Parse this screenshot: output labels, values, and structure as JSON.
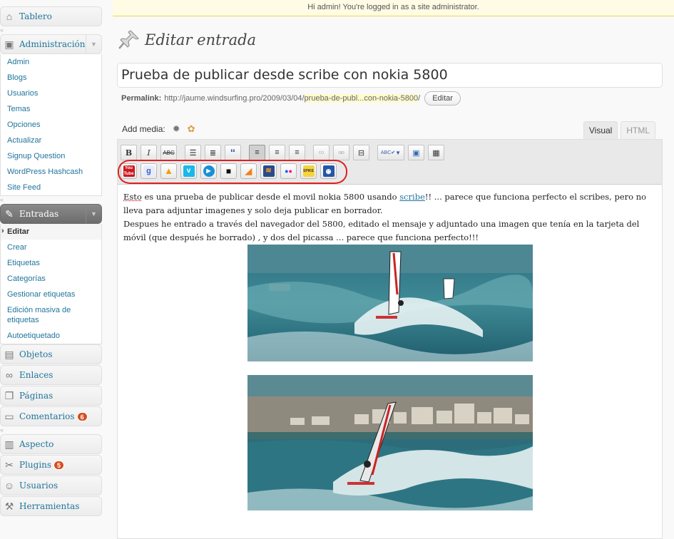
{
  "topbar": {
    "message": "Hi admin! You're logged in as a site administrator."
  },
  "sidebar": {
    "dashboard": "Tablero",
    "admin_section": {
      "label": "Administración",
      "items": [
        "Admin",
        "Blogs",
        "Usuarios",
        "Temas",
        "Opciones",
        "Actualizar",
        "Signup Question",
        "WordPress Hashcash",
        "Site Feed"
      ]
    },
    "posts_section": {
      "label": "Entradas",
      "items": [
        "Editar",
        "Crear",
        "Etiquetas",
        "Categorías",
        "Gestionar etiquetas",
        "Edición masiva de etiquetas",
        "Autoetiquetado"
      ]
    },
    "menu": {
      "media": "Objetos",
      "links": "Enlaces",
      "pages": "Páginas",
      "comments": "Comentarios",
      "comments_count": "6",
      "appearance": "Aspecto",
      "plugins": "Plugins",
      "plugins_count": "5",
      "users": "Usuarios",
      "tools": "Herramientas"
    }
  },
  "page": {
    "heading": "Editar entrada"
  },
  "post": {
    "title": "Prueba de publicar desde scribe con nokia 5800",
    "permalink_label": "Permalink:",
    "permalink_base": "http://jaume.windsurfing.pro/2009/03/04/",
    "permalink_slug": "prueba-de-publ...con-nokia-5800",
    "permalink_end": "/",
    "edit_button": "Editar"
  },
  "media": {
    "label": "Add media:"
  },
  "editor_tabs": {
    "visual": "Visual",
    "html": "HTML"
  },
  "toolbar": {
    "bold": "B",
    "italic": "I",
    "strike": "ABC",
    "spell": "ABC"
  },
  "media_buttons": [
    {
      "name": "youtube",
      "label": "You Tube",
      "color": "#cc181e"
    },
    {
      "name": "google-video",
      "label": "g",
      "color": "#3a5fcd"
    },
    {
      "name": "metacafe",
      "label": "▲",
      "color": "#f0a000"
    },
    {
      "name": "vimeo",
      "label": "v",
      "color": "#1ab7ea"
    },
    {
      "name": "dailymotion",
      "label": "▶",
      "color": "#1a8fd6"
    },
    {
      "name": "video-camera",
      "label": "●",
      "color": "#111111"
    },
    {
      "name": "myspace",
      "label": "◢",
      "color": "#f08020"
    },
    {
      "name": "revver",
      "label": "≋",
      "color": "#2b4a8b"
    },
    {
      "name": "flickr",
      "label": "●●",
      "color": "#ffffff"
    },
    {
      "name": "spike",
      "label": "SPIKE",
      "color": "#f6d43b"
    },
    {
      "name": "bliptv",
      "label": "●",
      "color": "#2456a6"
    }
  ],
  "content": {
    "p1_a": "Esto",
    "p1_b": " es una prueba de publicar desde el movil nokia 5800 usando ",
    "p1_link": "scribe",
    "p1_c": "!! ... parece que funciona perfecto el scribes, pero no lleva para adjuntar imagenes y solo deja publicar en borrador.",
    "p2": "Despues he entrado a través del navegador del 5800, editado el mensaje y adjuntado una imagen que tenía en la tarjeta del móvil (que después he borrado) , y dos del picassa ... parece que funciona perfecto!!!"
  }
}
